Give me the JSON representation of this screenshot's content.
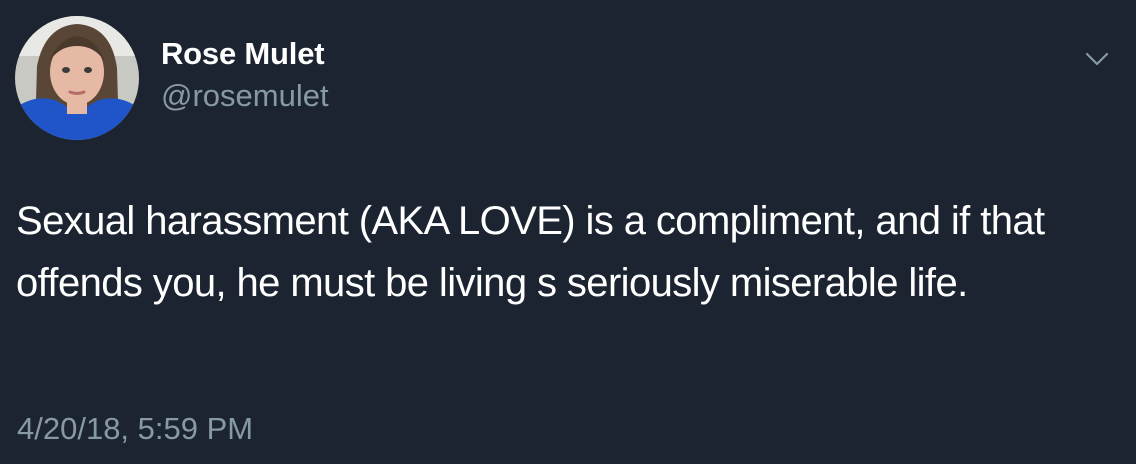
{
  "author": {
    "display_name": "Rose Mulet",
    "handle": "@rosemulet",
    "avatar_icon": "profile-photo"
  },
  "menu": {
    "icon": "chevron-down-icon"
  },
  "tweet": {
    "text": "Sexual harassment (AKA LOVE) is a compliment, and if that offends you, he must be living s seriously miserable life.",
    "timestamp": "4/20/18, 5:59 PM"
  },
  "colors": {
    "background": "#1b2430",
    "primary_text": "#ffffff",
    "secondary_text": "#8899a6"
  }
}
